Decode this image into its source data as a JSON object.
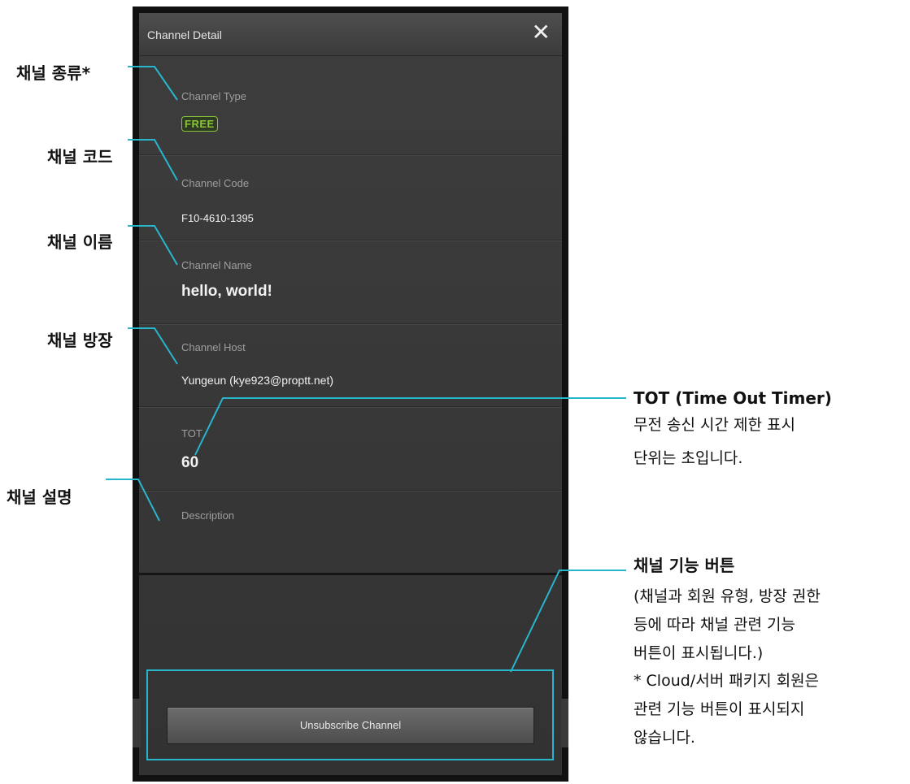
{
  "dialog": {
    "title": "Channel Detail",
    "close_glyph": "✕",
    "fields": [
      {
        "label": "Channel Type",
        "value": "FREE"
      },
      {
        "label": "Channel Code",
        "value": "F10-4610-1395"
      },
      {
        "label": "Channel Name",
        "value": "hello, world!"
      },
      {
        "label": "Channel Host",
        "value": "Yungeun (kye923@proptt.net)"
      },
      {
        "label": "TOT",
        "value": "60"
      },
      {
        "label": "Description",
        "value": ""
      }
    ],
    "unsubscribe_label": "Unsubscribe Channel"
  },
  "annotations": {
    "channel_type": "채널 종류*",
    "channel_code": "채널 코드",
    "channel_name": "채널 이름",
    "channel_host": "채널 방장",
    "channel_desc": "채널 설명",
    "tot_title": "TOT (Time Out Timer)",
    "tot_line1": "무전 송신 시간 제한 표시",
    "tot_line2": "단위는 초입니다.",
    "func_title": "채널 기능 버튼",
    "func_line1": "(채널과 회원 유형, 방장 권한",
    "func_line2": "등에 따라 채널 관련 기능",
    "func_line3": "버튼이 표시됩니다.)",
    "func_line4": "* Cloud/서버 패키지 회원은",
    "func_line5": "관련 기능 버튼이 표시되지",
    "func_line6": "않습니다."
  },
  "colors": {
    "annotation_line": "#27b6cc",
    "free_badge": "#8ac437",
    "panel_bg": "#383838"
  },
  "icons": {
    "close": "close-icon"
  }
}
